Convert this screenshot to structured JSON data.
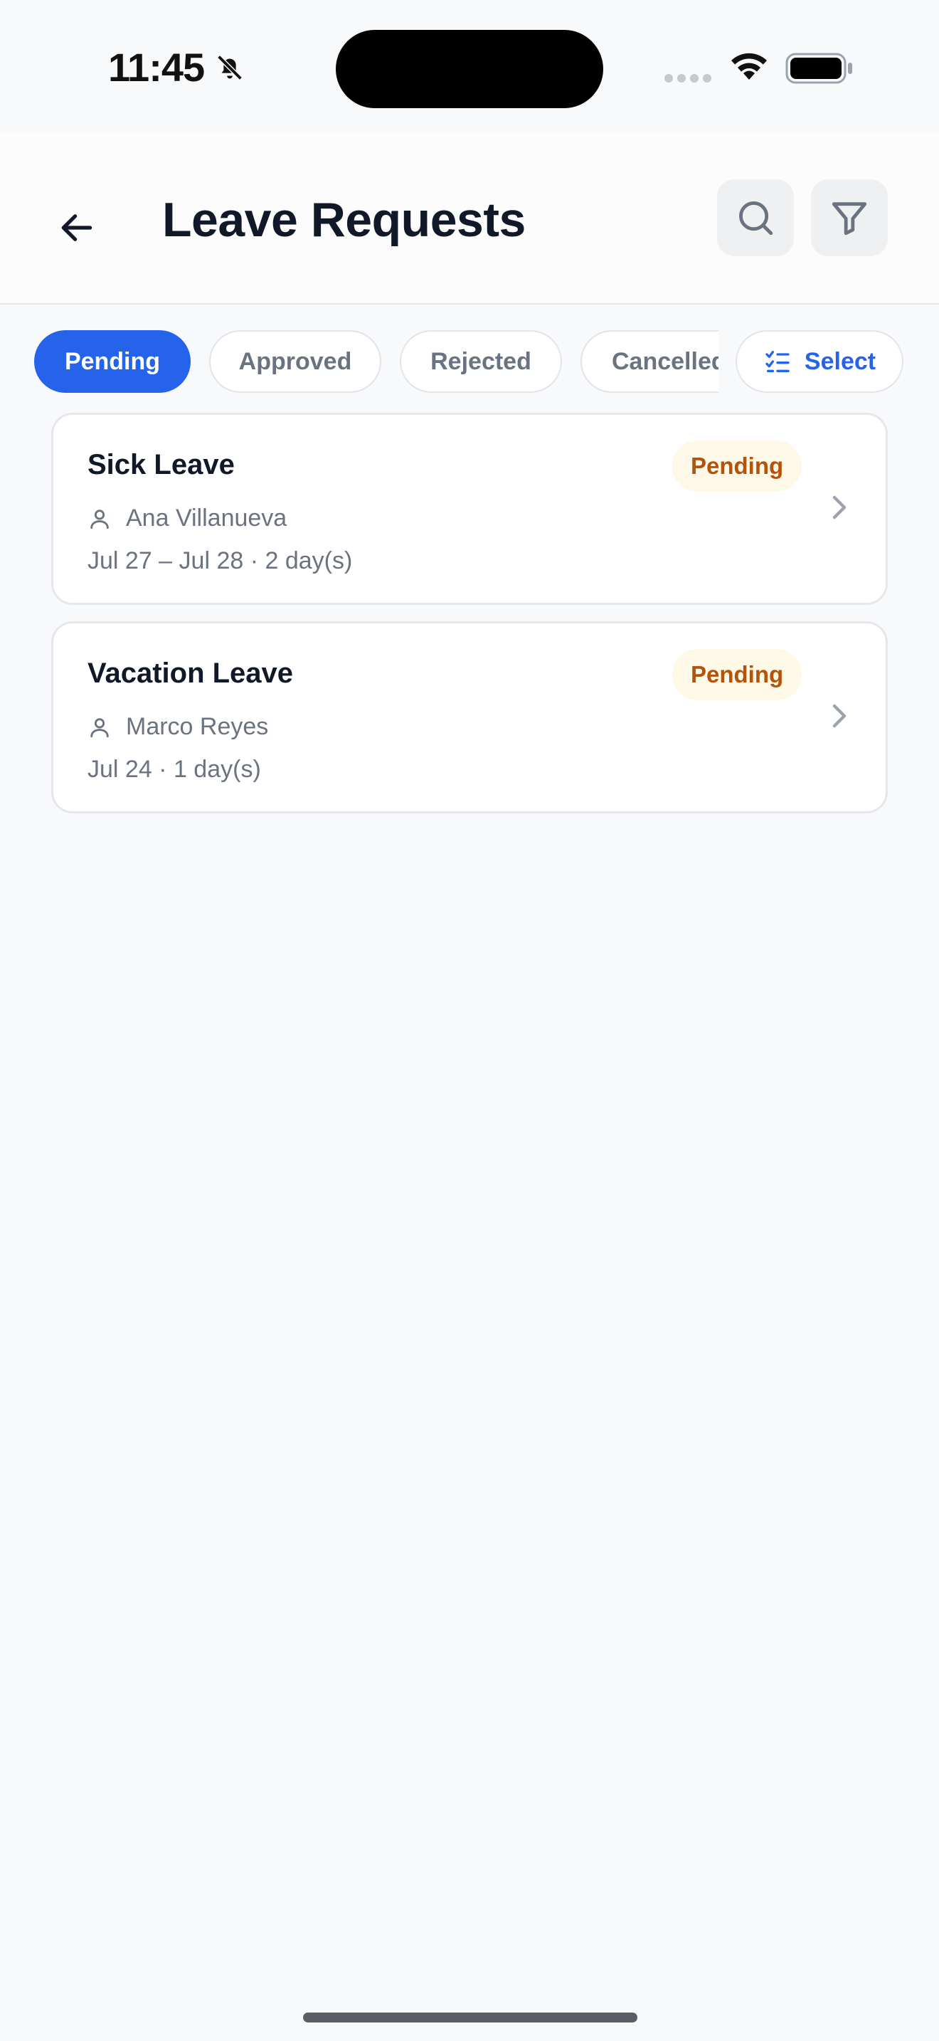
{
  "status_bar": {
    "time": "11:45"
  },
  "header": {
    "title": "Leave Requests"
  },
  "tabs": [
    {
      "label": "Pending",
      "active": true
    },
    {
      "label": "Approved",
      "active": false
    },
    {
      "label": "Rejected",
      "active": false
    },
    {
      "label": "Cancelled",
      "active": false
    }
  ],
  "select_label": "Select",
  "requests": [
    {
      "type": "Sick Leave",
      "status": "Pending",
      "employee": "Ana Villanueva",
      "dates": "Jul 27 – Jul 28 · 2 day(s)"
    },
    {
      "type": "Vacation Leave",
      "status": "Pending",
      "employee": "Marco Reyes",
      "dates": "Jul 24 · 1 day(s)"
    }
  ],
  "colors": {
    "accent": "#2563eb",
    "pending_bg": "#fef8e7",
    "pending_text": "#b45309"
  },
  "icons": [
    "bell-slash-icon",
    "wifi-icon",
    "battery-icon",
    "back-arrow-icon",
    "search-icon",
    "filter-icon",
    "checklist-icon",
    "person-icon",
    "chevron-right-icon"
  ]
}
